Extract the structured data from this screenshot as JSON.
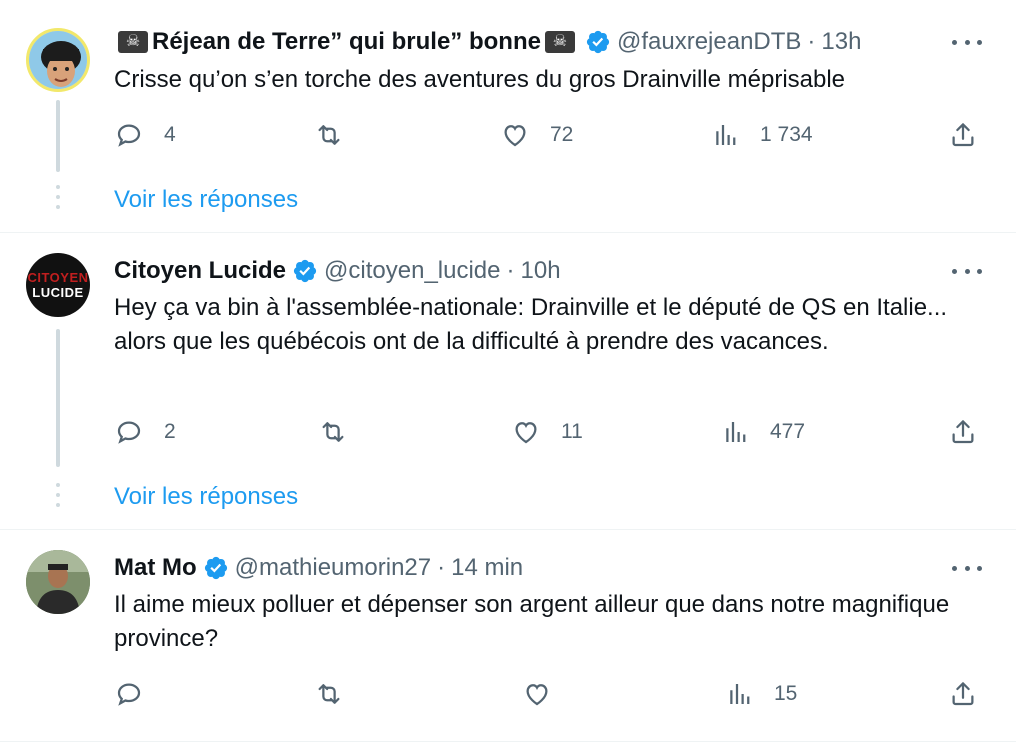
{
  "tweets": [
    {
      "display_name": "Réjean de Terre” qui brule” bonne",
      "flag_glyph": "☠",
      "handle": "@fauxrejeanDTB",
      "separator": "·",
      "time": "13h",
      "text": "Crisse qu’on s’en torche des aventures du gros Drainville méprisable",
      "replies": "4",
      "retweets": "",
      "likes": "72",
      "views": "1 734",
      "show_replies": "Voir les réponses"
    },
    {
      "display_name": "Citoyen Lucide",
      "avatar_text_top": "CITOYEN",
      "avatar_text_bottom": "LUCIDE",
      "handle": "@citoyen_lucide",
      "separator": "·",
      "time": "10h",
      "text": "Hey ça va bin à l'assemblée-nationale: Drainville et le député de QS en Italie... alors que les québécois ont de la difficulté à prendre des vacances.",
      "replies": "2",
      "retweets": "",
      "likes": "11",
      "views": "477",
      "show_replies": "Voir les réponses"
    },
    {
      "display_name": "Mat Mo",
      "handle": "@mathieumorin27",
      "separator": "·",
      "time": "14 min",
      "text": "Il aime mieux polluer et dépenser son argent ailleur que dans notre magnifique province?",
      "replies": "",
      "retweets": "",
      "likes": "",
      "views": "15"
    }
  ],
  "colors": {
    "accent": "#1d9bf0",
    "muted": "#536471",
    "text": "#0f1419",
    "border": "#eff3f4"
  }
}
